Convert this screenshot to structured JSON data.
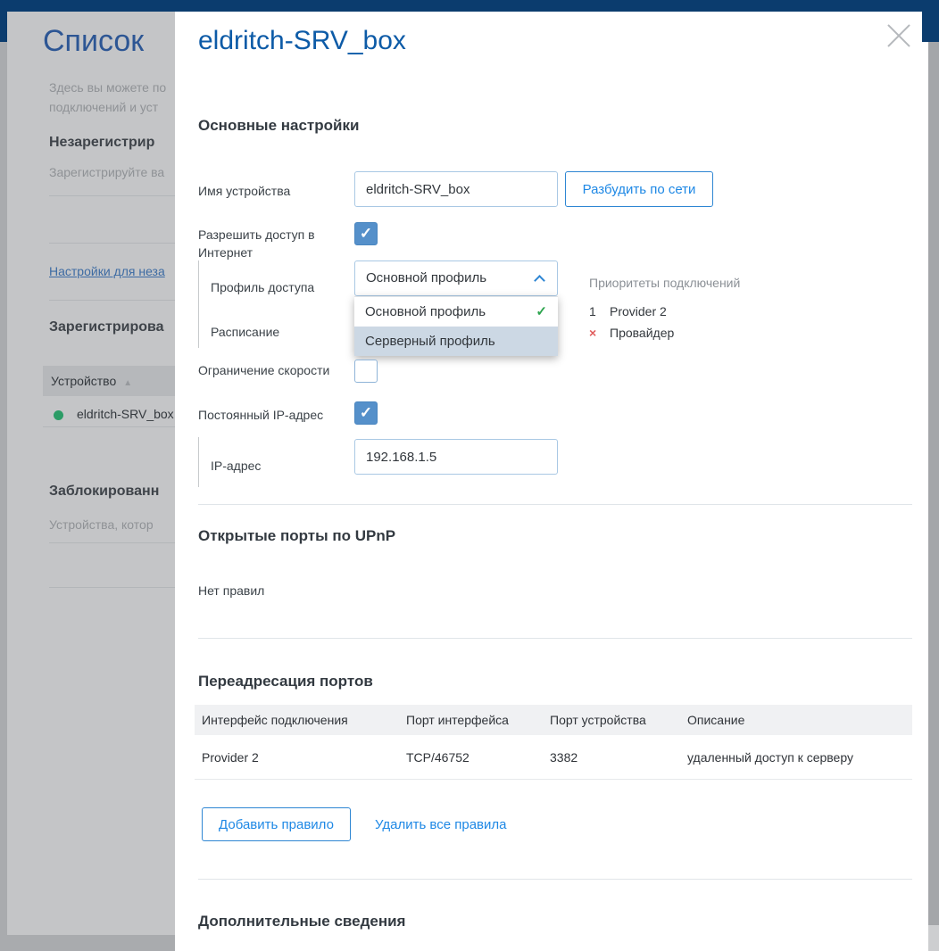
{
  "background_page": {
    "title": "Список",
    "intro_line1": "Здесь вы можете по",
    "intro_line2": "подключений и уст",
    "unregistered_heading": "Незарегистрир",
    "unregistered_text": "Зарегистрируйте ва",
    "settings_link": "Настройки для неза",
    "registered_heading": "Зарегистрирова",
    "device_column": "Устройство",
    "device_name": "eldritch-SRV_box",
    "blocked_heading": "Заблокированн",
    "blocked_text": "Устройства, котор"
  },
  "modal": {
    "title": "eldritch-SRV_box",
    "general": {
      "heading": "Основные настройки",
      "device_name_label": "Имя устройства",
      "device_name_value": "eldritch-SRV_box",
      "wake_button_label": "Разбудить по сети",
      "internet_access_label": "Разрешить доступ в Интернет",
      "access_profile_label": "Профиль доступа",
      "access_profile_value": "Основной профиль",
      "profile_options": [
        {
          "label": "Основной профиль",
          "selected": true
        },
        {
          "label": "Серверный профиль",
          "selected": false
        }
      ],
      "schedule_label": "Расписание",
      "priorities_heading": "Приоритеты подключений",
      "priorities": [
        {
          "rank": "1",
          "name": "Provider 2"
        },
        {
          "rank": "×",
          "name": "Провайдер"
        }
      ],
      "speed_limit_label": "Ограничение скорости",
      "static_ip_label": "Постоянный IP-адрес",
      "ip_label": "IP-адрес",
      "ip_value": "192.168.1.5"
    },
    "upnp": {
      "heading": "Открытые порты по UPnP",
      "empty_text": "Нет правил"
    },
    "port_forwarding": {
      "heading": "Переадресация портов",
      "columns": [
        "Интерфейс подключения",
        "Порт интерфейса",
        "Порт устройства",
        "Описание"
      ],
      "rows": [
        [
          "Provider 2",
          "TCP/46752",
          "3382",
          "удаленный доступ к серверу"
        ]
      ],
      "add_button_label": "Добавить правило",
      "delete_all_label": "Удалить все правила"
    },
    "additional": {
      "heading": "Дополнительные сведения"
    }
  },
  "icons": {
    "check": "✓",
    "sort_asc": "▲"
  },
  "colors": {
    "navy_header": "#0b3c6e",
    "modal_title_blue": "#0d5ba7",
    "accent_blue": "#1e88e5",
    "checkbox_blue": "#5590ca",
    "option_highlight": "#ccd8e4",
    "green_check": "#2da44e",
    "red_cross": "#e05c5c",
    "online_green": "#2c9c66"
  }
}
